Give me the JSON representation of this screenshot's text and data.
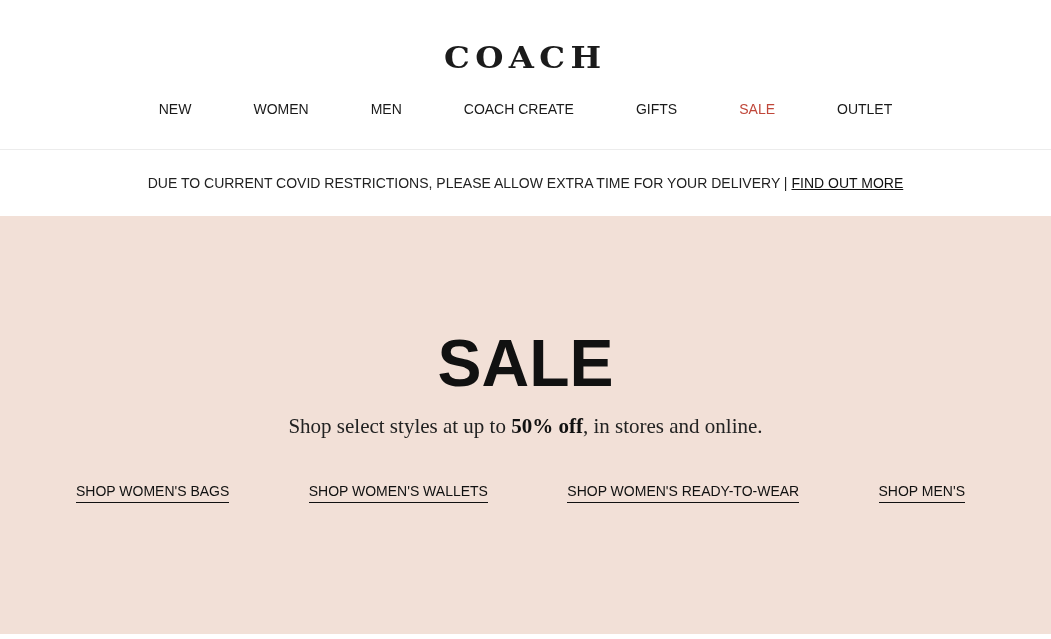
{
  "logo": "COACH",
  "nav": [
    {
      "label": "NEW",
      "highlight": false
    },
    {
      "label": "WOMEN",
      "highlight": false
    },
    {
      "label": "MEN",
      "highlight": false
    },
    {
      "label": "COACH CREATE",
      "highlight": false
    },
    {
      "label": "GIFTS",
      "highlight": false
    },
    {
      "label": "SALE",
      "highlight": true
    },
    {
      "label": "OUTLET",
      "highlight": false
    }
  ],
  "notice": {
    "text": "DUE TO CURRENT COVID RESTRICTIONS, PLEASE ALLOW EXTRA TIME FOR YOUR DELIVERY |",
    "link": "FIND OUT MORE"
  },
  "hero": {
    "title": "SALE",
    "subtitle": "Shop select styles at up to **50% off**, in stores and online.",
    "links": [
      "SHOP WOMEN'S BAGS",
      "SHOP WOMEN'S WALLETS",
      "SHOP WOMEN'S READY-TO-WEAR",
      "SHOP MEN'S"
    ]
  }
}
